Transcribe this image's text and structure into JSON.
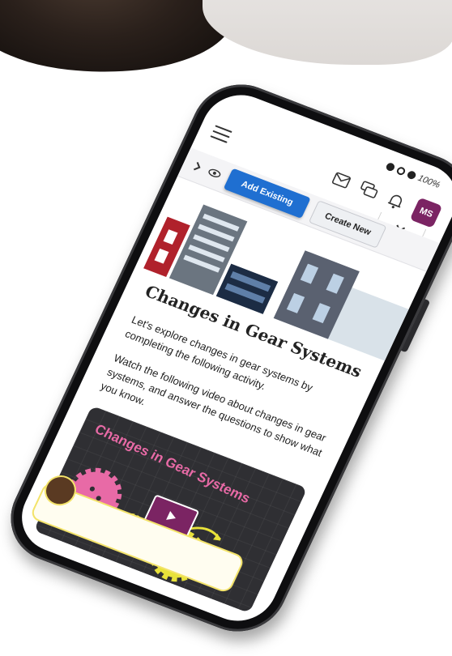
{
  "status": {
    "battery": "100%"
  },
  "header": {
    "menu_icon": "hamburger-icon",
    "icons": [
      "mail-icon",
      "chat-icon",
      "bell-icon"
    ],
    "avatar_initials": "MS"
  },
  "toolbar": {
    "add_existing_label": "Add Existing",
    "create_new_label": "Create New"
  },
  "lesson": {
    "title": "Changes in Gear Systems",
    "paragraph_1": "Let's explore changes in gear systems by completing the following activity.",
    "paragraph_2": "Watch the following video about changes in gear systems, and answer the questions to show what you know."
  },
  "video": {
    "title": "Changes in Gear Systems"
  },
  "colors": {
    "brand": "#7b2463",
    "primary_button": "#1f6fd1",
    "gear_pink": "#e86aa6",
    "gear_yellow": "#e8e23a",
    "chat_border": "#f3e36a"
  }
}
